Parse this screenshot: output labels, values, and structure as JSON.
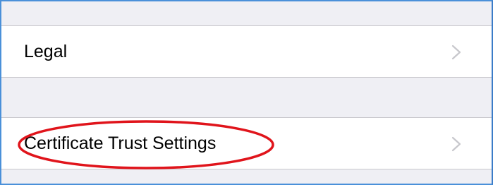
{
  "settings": {
    "rows": [
      {
        "label": "Legal",
        "accessory_icon": "chevron-right-icon"
      },
      {
        "label": "Certificate Trust Settings",
        "accessory_icon": "chevron-right-icon"
      }
    ]
  },
  "colors": {
    "group_background": "#efeff4",
    "cell_background": "#ffffff",
    "separator": "#c8c7cc",
    "chevron": "#c7c7cc",
    "annotation_ring": "#e0141b",
    "frame_border": "#4a90d9"
  }
}
